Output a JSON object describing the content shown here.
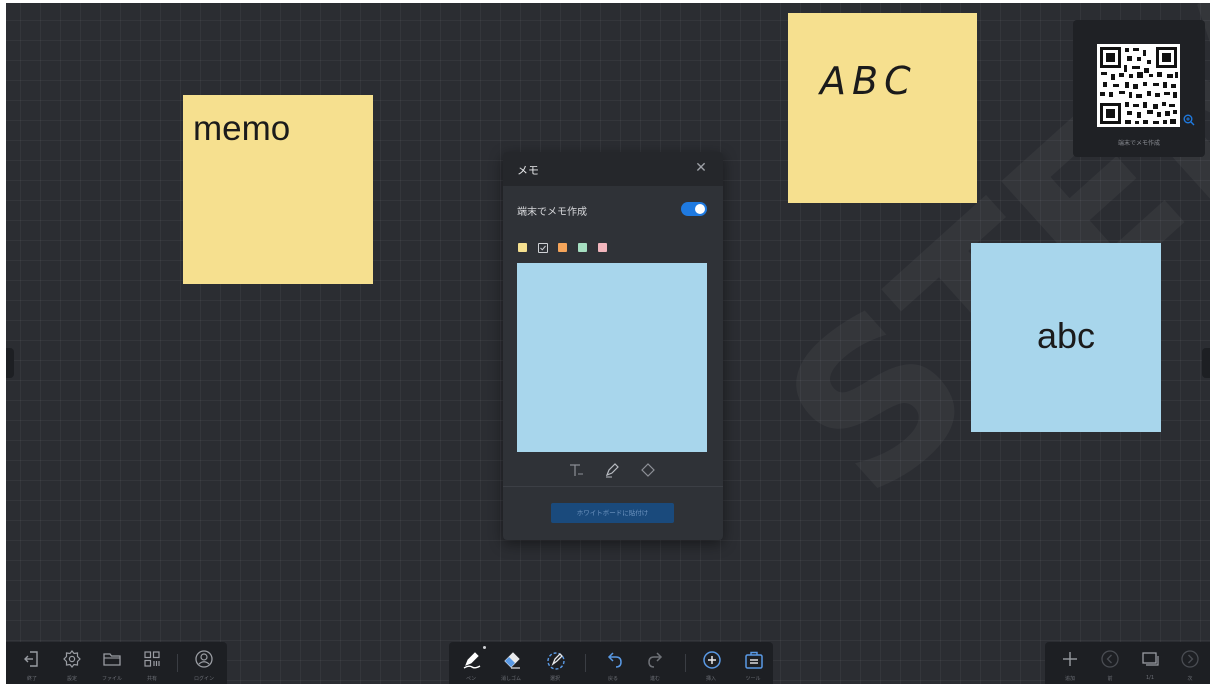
{
  "board": {
    "watermark_text": "STEM",
    "background_color": "#2b2d32"
  },
  "notes": [
    {
      "text": "memo",
      "color": "#f6e08f"
    },
    {
      "text": "ABC",
      "color": "#f6e08f"
    },
    {
      "text": "abc",
      "color": "#a8d6ec"
    }
  ],
  "qr_panel": {
    "caption": "端末でメモ作成",
    "zoom_icon": "zoom-in-icon"
  },
  "memo_dialog": {
    "title": "メモ",
    "close_icon": "close-icon",
    "device_memo_label": "端末でメモ作成",
    "device_memo_enabled": true,
    "swatch_colors": [
      "#f6e08f",
      "#a8d6ec",
      "#f5a55a",
      "#a6dfc1",
      "#f2b6bd"
    ],
    "selected_swatch_index": 1,
    "preview_color": "#a8d6ec",
    "tools": [
      "text-tool-icon",
      "pen-tool-icon",
      "eraser-tool-icon"
    ],
    "paste_button_label": "ホワイトボードに貼付け"
  },
  "toolbar_left": [
    {
      "label": "終了",
      "icon": "exit-icon"
    },
    {
      "label": "設定",
      "icon": "gear-icon"
    },
    {
      "label": "ファイル",
      "icon": "folder-icon"
    },
    {
      "label": "共有",
      "icon": "share-grid-icon"
    },
    {
      "label": "ログイン",
      "icon": "user-icon"
    }
  ],
  "toolbar_center": [
    {
      "label": "ペン",
      "icon": "pen-icon",
      "active": true
    },
    {
      "label": "消しゴム",
      "icon": "eraser-icon"
    },
    {
      "label": "選択",
      "icon": "select-icon"
    },
    {
      "label": "戻る",
      "icon": "undo-icon"
    },
    {
      "label": "進む",
      "icon": "redo-icon"
    },
    {
      "label": "挿入",
      "icon": "insert-icon"
    },
    {
      "label": "ツール",
      "icon": "toolbox-icon"
    }
  ],
  "toolbar_right": [
    {
      "label": "追加",
      "icon": "plus-icon"
    },
    {
      "label": "前",
      "icon": "prev-page-icon"
    },
    {
      "label": "1/1",
      "icon": "pages-icon"
    },
    {
      "label": "次",
      "icon": "next-page-icon"
    }
  ],
  "accent_color": "#1f7ae0"
}
